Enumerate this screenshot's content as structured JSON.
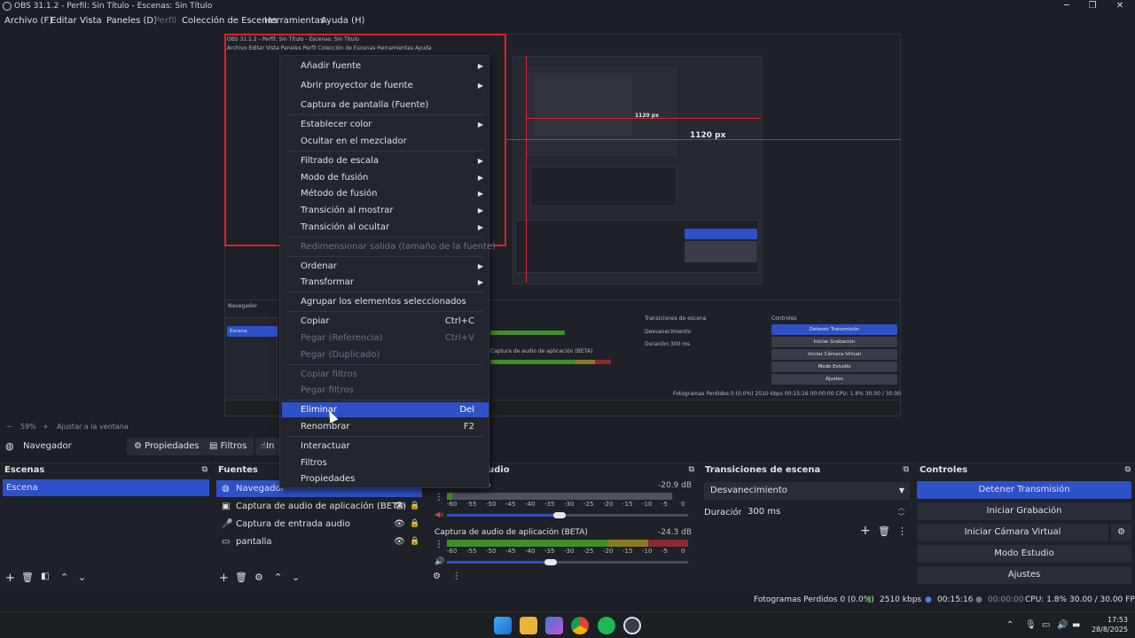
{
  "window": {
    "title": "OBS 31.1.2 - Perfil: Sin Título - Escenas: Sin Título",
    "minimize": "─",
    "maximize": "❐",
    "close": "✕"
  },
  "menubar": [
    {
      "label": "Archivo (F)",
      "disabled": false
    },
    {
      "label": "Editar",
      "disabled": false
    },
    {
      "label": "Vista",
      "disabled": false
    },
    {
      "label": "Paneles (D)",
      "disabled": false
    },
    {
      "label": "Perfil",
      "disabled": true
    },
    {
      "label": "Colección de Escenas",
      "disabled": false
    },
    {
      "label": "Herramientas",
      "disabled": false
    },
    {
      "label": "Ayuda (H)",
      "disabled": false
    }
  ],
  "preview": {
    "nested_label_1": "1120 px",
    "nested_label_2": "1120 px"
  },
  "zoombar": {
    "minus": "−",
    "zoom": "59%",
    "plus": "+",
    "fit": "Ajustar a la ventana"
  },
  "contextbar": {
    "source_name": "Navegador",
    "properties": "Propiedades",
    "filters": "Filtros",
    "interact_partial": "In"
  },
  "scenes": {
    "title": "Escenas",
    "items": [
      "Escena"
    ]
  },
  "sources": {
    "title": "Fuentes",
    "items": [
      {
        "label": "Navegador",
        "icon": "globe-icon"
      },
      {
        "label": "Captura de audio de aplicación (BETA)",
        "icon": "app-audio-icon"
      },
      {
        "label": "Captura de entrada audio",
        "icon": "microphone-icon"
      },
      {
        "label": "pantalla",
        "icon": "monitor-icon"
      }
    ]
  },
  "mixer": {
    "title_partial": "udio",
    "channel1": {
      "name_partial": "o",
      "db": "-20.9 dB"
    },
    "channel2": {
      "name": "Captura de audio de aplicación (BETA)",
      "db": "-24.3 dB"
    },
    "ticks": [
      "-60",
      "-55",
      "-50",
      "-45",
      "-40",
      "-35",
      "-30",
      "-25",
      "-20",
      "-15",
      "-10",
      "-5",
      "0"
    ]
  },
  "transitions": {
    "title": "Transiciones de escena",
    "selected": "Desvanecimiento",
    "duration_label": "Duración",
    "duration_value": "300 ms"
  },
  "controls": {
    "title": "Controles",
    "buttons": [
      "Detener Transmisión",
      "Iniciar Grabación",
      "Iniciar Cámara Virtual",
      "Modo Estudio",
      "Ajustes"
    ]
  },
  "statusbar": {
    "dropped": "Fotogramas Perdidos 0 (0.0%)",
    "bitrate": "2510 kbps",
    "stream_time": "00:15:16",
    "rec_time": "00:00:00",
    "cpu": "CPU: 1.8%",
    "fps": "30.00 / 30.00 FPS"
  },
  "context_menu": {
    "items": [
      {
        "label": "Añadir fuente",
        "submenu": true
      },
      {
        "label": "Abrir proyector de fuente",
        "submenu": true
      },
      {
        "label": "Captura de pantalla (Fuente)"
      },
      {
        "label": "Establecer color",
        "submenu": true
      },
      {
        "label": "Ocultar en el mezclador"
      },
      {
        "label": "Filtrado de escala",
        "submenu": true
      },
      {
        "label": "Modo de fusión",
        "submenu": true
      },
      {
        "label": "Método de fusión",
        "submenu": true
      },
      {
        "label": "Transición al mostrar",
        "submenu": true
      },
      {
        "label": "Transición al ocultar",
        "submenu": true
      },
      {
        "label": "Redimensionar salida (tamaño de la fuente)",
        "disabled": true
      },
      {
        "label": "Ordenar",
        "submenu": true
      },
      {
        "label": "Transformar",
        "submenu": true
      },
      {
        "label": "Agrupar los elementos seleccionados"
      },
      {
        "label": "Copiar",
        "shortcut": "Ctrl+C"
      },
      {
        "label": "Pegar (Referencia)",
        "shortcut": "Ctrl+V",
        "disabled": true
      },
      {
        "label": "Pegar (Duplicado)",
        "disabled": true
      },
      {
        "label": "Copiar filtros",
        "disabled": true
      },
      {
        "label": "Pegar filtros",
        "disabled": true
      },
      {
        "label": "Eliminar",
        "shortcut": "Del",
        "highlighted": true
      },
      {
        "label": "Renombrar",
        "shortcut": "F2"
      },
      {
        "label": "Interactuar"
      },
      {
        "label": "Filtros"
      },
      {
        "label": "Propiedades"
      }
    ]
  },
  "taskbar": {
    "time": "17:53",
    "date": "28/8/2025"
  }
}
